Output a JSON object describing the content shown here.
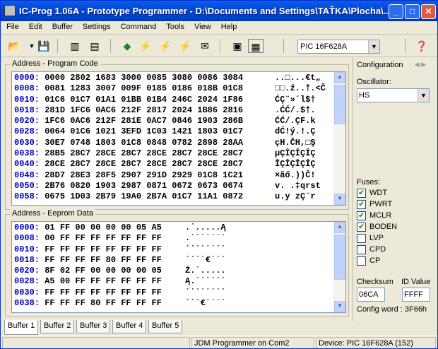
{
  "title": "IC-Prog 1.06A - Prototype Programmer - D:\\Documents and Settings\\TAŤKA\\Plocha\\...",
  "menu": [
    "File",
    "Edit",
    "Buffer",
    "Settings",
    "Command",
    "Tools",
    "View",
    "Help"
  ],
  "device_select": "PIC 16F628A",
  "program_code": {
    "header": "Address - Program Code",
    "rows": [
      {
        "addr": "0000:",
        "data": "0000 2802 1683 3000 0085 3080 0086 3084",
        "ascii": "..□...€t„"
      },
      {
        "addr": "0008:",
        "data": "0081 1283 3007 009F 0185 0186 018B 01C8",
        "ascii": "□□.ź..†.<Č"
      },
      {
        "addr": "0010:",
        "data": "01C6 01C7 01A1 01BB 01B4 246C 2024 1F86",
        "ascii": "ĆÇ¨»´l$†"
      },
      {
        "addr": "0018:",
        "data": "281D 1FC6 0AC6 212F 2817 2024 1B86 2816",
        "ascii": ".ĆĆ/.$†."
      },
      {
        "addr": "0020:",
        "data": "1FC6 0AC6 212F 281E 0AC7 0846 1903 286B",
        "ascii": "ĆĆ/.ÇF.k"
      },
      {
        "addr": "0028:",
        "data": "0064 01C6 1021 3EFD 1C03 1421 1803 01C7",
        "ascii": "dĆ!ý.!.Ç"
      },
      {
        "addr": "0030:",
        "data": "30E7 0748 1803 01C8 0848 0782 2898 28AA",
        "ascii": "çH.ČH,□Ş"
      },
      {
        "addr": "0038:",
        "data": "28B5 28C7 28CE 28C7 28CE 28C7 28CE 28C7",
        "ascii": "µÇÎÇÎÇÎÇ"
      },
      {
        "addr": "0040:",
        "data": "28CE 28C7 28CE 28C7 28CE 28C7 28CE 28C7",
        "ascii": "ÎÇÎÇÎÇÎÇ"
      },
      {
        "addr": "0048:",
        "data": "28D7 28E3 28F5 2907 291D 2929 01C8 1C21",
        "ascii": "×ăő.))Č!"
      },
      {
        "addr": "0050:",
        "data": "2B76 0820 1903 2987 0871 0672 0673 0674",
        "ascii": "v. .‡qrst"
      },
      {
        "addr": "0058:",
        "data": "0675 1D03 2B79 19A0 2B7A 01C7 11A1 0872",
        "ascii": "u.y zÇ¨r"
      }
    ]
  },
  "eeprom": {
    "header": "Address - Eeprom Data",
    "rows": [
      {
        "addr": "0000:",
        "data": "01 FF 00 00 00 00 05 A5",
        "ascii": ".˙.....Ą"
      },
      {
        "addr": "0008:",
        "data": "00 FF FF FF FF FF FF FF",
        "ascii": ".˙˙˙˙˙˙˙"
      },
      {
        "addr": "0010:",
        "data": "FF FF FF FF FF FF FF FF",
        "ascii": "˙˙˙˙˙˙˙˙"
      },
      {
        "addr": "0018:",
        "data": "FF FF FF FF 80 FF FF FF",
        "ascii": "˙˙˙˙€˙˙˙"
      },
      {
        "addr": "0020:",
        "data": "8F 02 FF 00 00 00 00 05",
        "ascii": "Ź.˙....."
      },
      {
        "addr": "0028:",
        "data": "A5 00 FF FF FF FF FF FF",
        "ascii": "Ą.˙˙˙˙˙˙"
      },
      {
        "addr": "0030:",
        "data": "FF FF FF FF FF FF FF FF",
        "ascii": "˙˙˙˙˙˙˙˙"
      },
      {
        "addr": "0038:",
        "data": "FF FF FF 80 FF FF FF FF",
        "ascii": "˙˙˙€˙˙˙˙"
      }
    ]
  },
  "config": {
    "header": "Configuration",
    "oscillator_label": "Oscillator:",
    "oscillator": "HS",
    "fuses_label": "Fuses:",
    "fuses": [
      {
        "name": "WDT",
        "checked": true
      },
      {
        "name": "PWRT",
        "checked": true
      },
      {
        "name": "MCLR",
        "checked": true
      },
      {
        "name": "BODEN",
        "checked": true
      },
      {
        "name": "LVP",
        "checked": false
      },
      {
        "name": "CPD",
        "checked": false
      },
      {
        "name": "CP",
        "checked": false
      }
    ],
    "checksum_label": "Checksum",
    "checksum": "06CA",
    "id_label": "ID Value",
    "id_value": "FFFF",
    "config_word": "Config word : 3F66h"
  },
  "tabs": [
    "Buffer 1",
    "Buffer 2",
    "Buffer 3",
    "Buffer 4",
    "Buffer 5"
  ],
  "status": {
    "programmer": "JDM Programmer on Com2",
    "device": "Device: PIC 16F628A   (152)"
  }
}
